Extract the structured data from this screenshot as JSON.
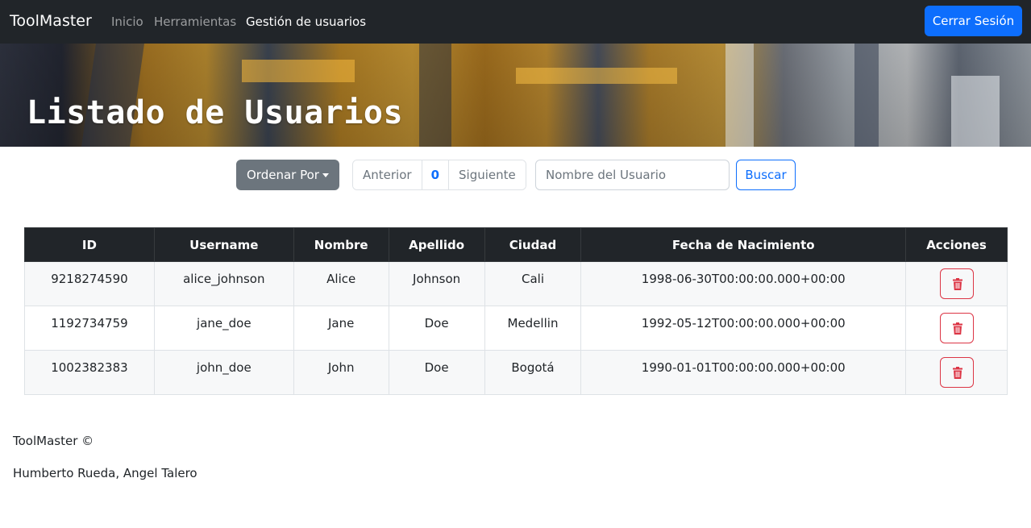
{
  "navbar": {
    "brand": "ToolMaster",
    "links": [
      {
        "label": "Inicio",
        "active": false
      },
      {
        "label": "Herramientas",
        "active": false
      },
      {
        "label": "Gestión de usuarios",
        "active": true
      }
    ],
    "logout_label": "Cerrar Sesión"
  },
  "hero": {
    "title": "Listado de Usuarios"
  },
  "controls": {
    "sort_label": "Ordenar Por",
    "pager": {
      "prev": "Anterior",
      "page": "0",
      "next": "Siguiente"
    },
    "search": {
      "placeholder": "Nombre del Usuario",
      "value": "",
      "button": "Buscar"
    }
  },
  "table": {
    "headers": [
      "ID",
      "Username",
      "Nombre",
      "Apellido",
      "Ciudad",
      "Fecha de Nacimiento",
      "Acciones"
    ],
    "rows": [
      {
        "id": "9218274590",
        "username": "alice_johnson",
        "nombre": "Alice",
        "apellido": "Johnson",
        "ciudad": "Cali",
        "fecha": "1998-06-30T00:00:00.000+00:00",
        "action_icon": "trash-icon"
      },
      {
        "id": "1192734759",
        "username": "jane_doe",
        "nombre": "Jane",
        "apellido": "Doe",
        "ciudad": "Medellin",
        "fecha": "1992-05-12T00:00:00.000+00:00",
        "action_icon": "trash-icon"
      },
      {
        "id": "1002382383",
        "username": "john_doe",
        "nombre": "John",
        "apellido": "Doe",
        "ciudad": "Bogotá",
        "fecha": "1990-01-01T00:00:00.000+00:00",
        "action_icon": "trash-icon"
      }
    ]
  },
  "footer": {
    "copyright": "ToolMaster ©",
    "authors": "Humberto Rueda, Angel Talero"
  },
  "colors": {
    "navbar_bg": "#212529",
    "primary": "#0d6efd",
    "secondary": "#6c757d",
    "danger": "#dc3545"
  }
}
